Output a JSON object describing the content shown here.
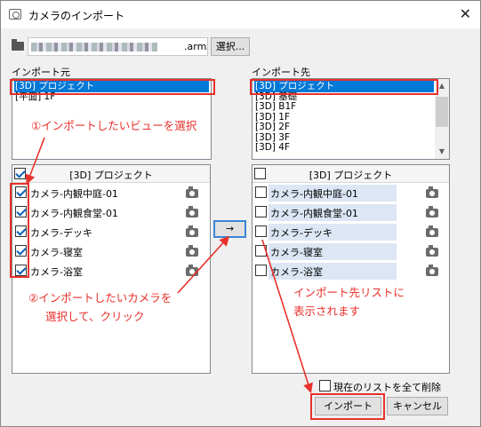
{
  "window": {
    "title": "カメラのインポート"
  },
  "file": {
    "extension": ".armz",
    "select_label": "選択..."
  },
  "source": {
    "section_label": "インポート元",
    "views": [
      "[3D] プロジェクト",
      "[平面] 1F"
    ],
    "selected_view": 0,
    "header": "[3D] プロジェクト",
    "cameras": [
      {
        "label": "カメラ-内観中庭-01",
        "checked": true
      },
      {
        "label": "カメラ-内観食堂-01",
        "checked": true
      },
      {
        "label": "カメラ-デッキ",
        "checked": true
      },
      {
        "label": "カメラ-寝室",
        "checked": true
      },
      {
        "label": "カメラ-浴室",
        "checked": true
      }
    ]
  },
  "target": {
    "section_label": "インポート先",
    "views": [
      "[3D] プロジェクト",
      "[3D] 基礎",
      "[3D] B1F",
      "[3D] 1F",
      "[3D] 2F",
      "[3D] 3F",
      "[3D] 4F"
    ],
    "selected_view": 0,
    "header": "[3D] プロジェクト",
    "cameras": [
      {
        "label": "カメラ-内観中庭-01",
        "checked": false
      },
      {
        "label": "カメラ-内観食堂-01",
        "checked": false
      },
      {
        "label": "カメラ-デッキ",
        "checked": false
      },
      {
        "label": "カメラ-寝室",
        "checked": false
      },
      {
        "label": "カメラ-浴室",
        "checked": false
      }
    ]
  },
  "transfer_label": "→",
  "delete_all_label": "現在のリストを全て削除",
  "buttons": {
    "import": "インポート",
    "cancel": "キャンセル"
  },
  "annotations": {
    "step1": "①インポートしたいビューを選択",
    "step2_line1": "②インポートしたいカメラを",
    "step2_line2": "選択して、クリック",
    "result_line1": "インポート先リストに",
    "result_line2": "表示されます"
  },
  "colors": {
    "annotation": "#e8312a",
    "selection": "#0078d7",
    "target_row": "#dce6f4"
  }
}
